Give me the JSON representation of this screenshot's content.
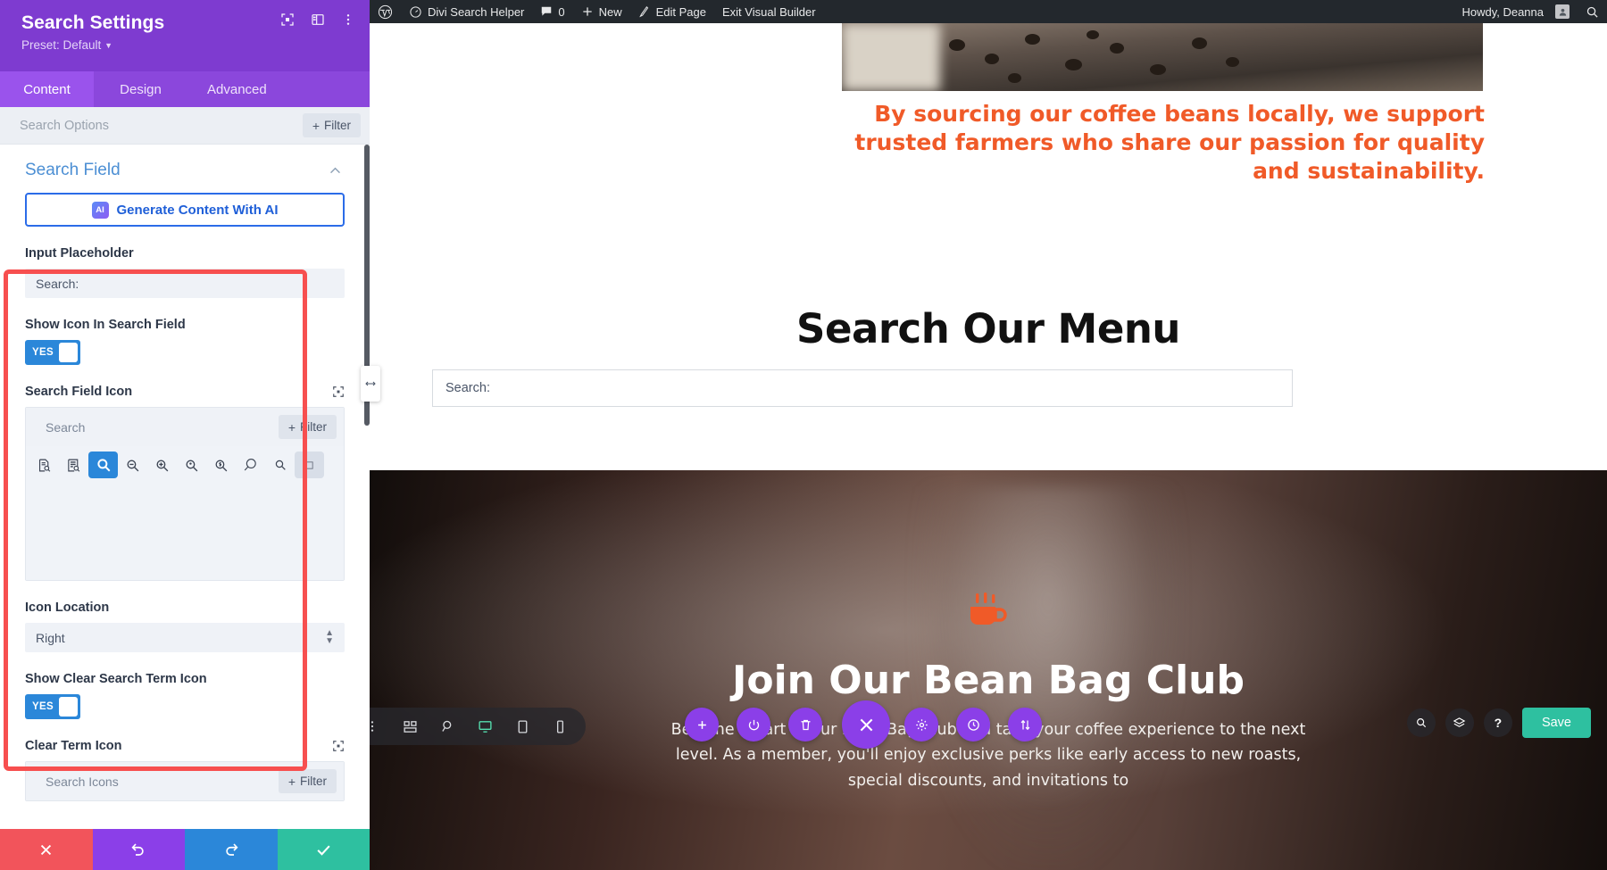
{
  "settings_panel": {
    "title": "Search Settings",
    "preset_label": "Preset: Default",
    "header_icons": [
      {
        "name": "fullscreen-icon"
      },
      {
        "name": "layout-columns-icon"
      },
      {
        "name": "more-options-icon"
      }
    ],
    "tabs": [
      {
        "label": "Content",
        "active": true
      },
      {
        "label": "Design",
        "active": false
      },
      {
        "label": "Advanced",
        "active": false
      }
    ],
    "options_search": {
      "placeholder": "Search Options",
      "value": ""
    },
    "filter_button": {
      "label": "Filter",
      "plus": "+"
    },
    "section": {
      "title": "Search Field",
      "collapse_icon": "chevron-up-icon"
    },
    "ai_button": {
      "badge": "AI",
      "label": "Generate Content With AI"
    },
    "fields": {
      "input_placeholder": {
        "label": "Input Placeholder",
        "value": "Search:"
      },
      "show_icon_in_search_field": {
        "label": "Show Icon In Search Field",
        "toggle_value": "YES"
      },
      "search_field_icon": {
        "label": "Search Field Icon",
        "picker_placeholder": "Search",
        "picker_value": "",
        "filter_label": "Filter",
        "icons": [
          {
            "name": "document-search-icon",
            "selected": false
          },
          {
            "name": "list-search-icon",
            "selected": false
          },
          {
            "name": "magnifier-icon",
            "selected": true
          },
          {
            "name": "zoom-out-icon",
            "selected": false
          },
          {
            "name": "zoom-in-icon",
            "selected": false
          },
          {
            "name": "location-search-icon",
            "selected": false
          },
          {
            "name": "money-search-icon",
            "selected": false
          },
          {
            "name": "magnifier-outline-icon",
            "selected": false
          },
          {
            "name": "magnifier-small-icon",
            "selected": false
          }
        ]
      },
      "icon_location": {
        "label": "Icon Location",
        "value": "Right",
        "options": [
          "Left",
          "Right"
        ]
      },
      "show_clear_search_term_icon": {
        "label": "Show Clear Search Term Icon",
        "toggle_value": "YES"
      },
      "clear_term_icon": {
        "label": "Clear Term Icon",
        "picker_placeholder": "Search Icons",
        "filter_label": "Filter"
      }
    },
    "actions": [
      {
        "name": "cancel-button",
        "icon": "close-icon"
      },
      {
        "name": "undo-button",
        "icon": "undo-icon"
      },
      {
        "name": "redo-button",
        "icon": "redo-icon"
      },
      {
        "name": "save-button",
        "icon": "check-icon"
      }
    ],
    "highlight_color": "#F74F4F",
    "accent_color": "#7E3BD0"
  },
  "admin_bar": {
    "items": [
      {
        "name": "wp-logo",
        "label": ""
      },
      {
        "name": "site-name",
        "label": "Divi Search Helper"
      },
      {
        "name": "comments",
        "label": "0"
      },
      {
        "name": "new-content",
        "label": "New"
      },
      {
        "name": "edit-page",
        "label": "Edit Page"
      },
      {
        "name": "exit-visual-builder",
        "label": "Exit Visual Builder"
      }
    ],
    "howdy": "Howdy, Deanna",
    "search_icon": "search-icon"
  },
  "canvas": {
    "tagline": "By sourcing our coffee beans locally, we support trusted farmers who share our passion for quality and sustainability.",
    "tagline_color": "#F05A28",
    "menu_heading": "Search Our Menu",
    "menu_search_placeholder": "Search:",
    "hero": {
      "title": "Join Our Bean Bag Club",
      "paragraph": "Become a part of our Bean Bag Club and take your coffee experience to the next level. As a member, you'll enjoy exclusive perks like early access to new roasts, special discounts, and invitations to",
      "cup_icon": "coffee-cup-icon"
    }
  },
  "visual_builder": {
    "toolbar": [
      {
        "name": "vb-more-icon",
        "active": false
      },
      {
        "name": "wireframe-view-icon",
        "active": false
      },
      {
        "name": "zoom-view-icon",
        "active": false
      },
      {
        "name": "desktop-view-icon",
        "active": true
      },
      {
        "name": "tablet-view-icon",
        "active": false
      },
      {
        "name": "phone-view-icon",
        "active": false
      }
    ],
    "floating_circles": [
      {
        "name": "add-module-button",
        "icon": "plus-icon"
      },
      {
        "name": "power-button",
        "icon": "power-icon"
      },
      {
        "name": "delete-button",
        "icon": "trash-icon"
      },
      {
        "name": "close-button",
        "icon": "close-icon"
      },
      {
        "name": "settings-button",
        "icon": "gear-icon"
      },
      {
        "name": "history-button",
        "icon": "clock-icon"
      },
      {
        "name": "sort-button",
        "icon": "updown-arrows-icon"
      }
    ],
    "right_tools": [
      {
        "name": "search-tool",
        "icon": "search-icon"
      },
      {
        "name": "layers-tool",
        "icon": "layers-icon"
      },
      {
        "name": "help-tool",
        "icon": "question-icon"
      }
    ],
    "save_label": "Save",
    "save_color": "#2EC0A0"
  }
}
